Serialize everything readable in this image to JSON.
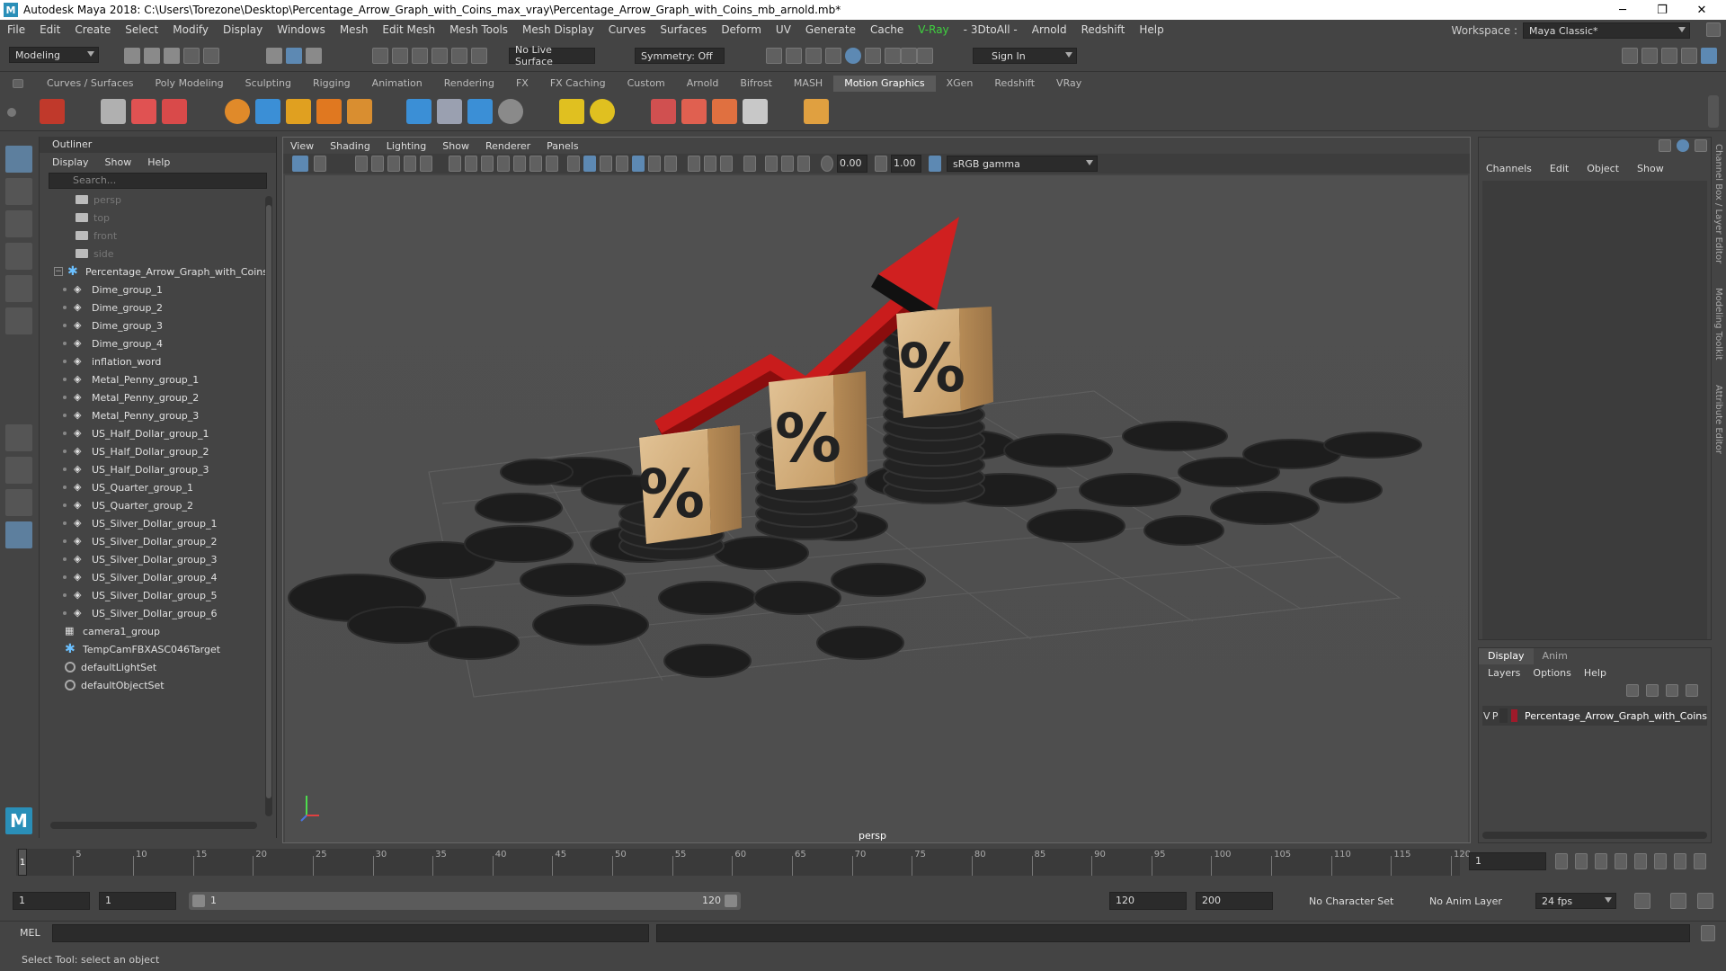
{
  "window": {
    "title": "Autodesk Maya 2018: C:\\Users\\Torezone\\Desktop\\Percentage_Arrow_Graph_with_Coins_max_vray\\Percentage_Arrow_Graph_with_Coins_mb_arnold.mb*",
    "minimize": "─",
    "maximize": "❐",
    "close": "✕"
  },
  "menubar": {
    "items": [
      "File",
      "Edit",
      "Create",
      "Select",
      "Modify",
      "Display",
      "Windows",
      "Mesh",
      "Edit Mesh",
      "Mesh Tools",
      "Mesh Display",
      "Curves",
      "Surfaces",
      "Deform",
      "UV",
      "Generate",
      "Cache",
      "V-Ray",
      "- 3DtoAll -",
      "Arnold",
      "Redshift",
      "Help"
    ],
    "workspace_label": "Workspace :",
    "workspace_value": "Maya Classic*"
  },
  "statusline": {
    "mode": "Modeling",
    "live_surface": "No Live Surface",
    "symmetry": "Symmetry: Off",
    "sign_in": "Sign In"
  },
  "shelf": {
    "tabs": [
      "Curves / Surfaces",
      "Poly Modeling",
      "Sculpting",
      "Rigging",
      "Animation",
      "Rendering",
      "FX",
      "FX Caching",
      "Custom",
      "Arnold",
      "Bifrost",
      "MASH",
      "Motion Graphics",
      "XGen",
      "Redshift",
      "VRay"
    ],
    "active_tab": "Motion Graphics"
  },
  "outliner": {
    "title": "Outliner",
    "menu": [
      "Display",
      "Show",
      "Help"
    ],
    "search_placeholder": "Search...",
    "cameras": [
      "persp",
      "top",
      "front",
      "side"
    ],
    "root": "Percentage_Arrow_Graph_with_Coins",
    "children": [
      "Dime_group_1",
      "Dime_group_2",
      "Dime_group_3",
      "Dime_group_4",
      "inflation_word",
      "Metal_Penny_group_1",
      "Metal_Penny_group_2",
      "Metal_Penny_group_3",
      "US_Half_Dollar_group_1",
      "US_Half_Dollar_group_2",
      "US_Half_Dollar_group_3",
      "US_Quarter_group_1",
      "US_Quarter_group_2",
      "US_Silver_Dollar_group_1",
      "US_Silver_Dollar_group_2",
      "US_Silver_Dollar_group_3",
      "US_Silver_Dollar_group_4",
      "US_Silver_Dollar_group_5",
      "US_Silver_Dollar_group_6"
    ],
    "others": [
      "camera1_group",
      "TempCamFBXASC046Target",
      "defaultLightSet",
      "defaultObjectSet"
    ]
  },
  "viewport": {
    "menu": [
      "View",
      "Shading",
      "Lighting",
      "Show",
      "Renderer",
      "Panels"
    ],
    "exposure": "0.00",
    "gamma": "1.00",
    "color_space": "sRGB gamma",
    "camera": "persp",
    "cube_glyph": "%"
  },
  "channelbox": {
    "menu": [
      "Channels",
      "Edit",
      "Object",
      "Show"
    ]
  },
  "layers": {
    "tabs": [
      "Display",
      "Anim"
    ],
    "menu": [
      "Layers",
      "Options",
      "Help"
    ],
    "row": {
      "v": "V",
      "p": "P",
      "name": "Percentage_Arrow_Graph_with_Coins",
      "color": "#9e1a2a"
    }
  },
  "side_tabs": [
    "Channel Box / Layer Editor",
    "Modeling Toolkit",
    "Attribute Editor"
  ],
  "timeslider": {
    "ticks": [
      "5",
      "10",
      "15",
      "20",
      "25",
      "30",
      "35",
      "40",
      "45",
      "50",
      "55",
      "60",
      "65",
      "70",
      "75",
      "80",
      "85",
      "90",
      "95",
      "100",
      "105",
      "110",
      "115",
      "120"
    ],
    "current": "1",
    "frame_field": "1"
  },
  "range": {
    "start": "1",
    "playback_start": "1",
    "range_start": "1",
    "range_end": "120",
    "playback_end": "120",
    "end": "200",
    "character_set": "No Character Set",
    "anim_layer": "No Anim Layer",
    "fps": "24 fps"
  },
  "cmdline": {
    "label": "MEL"
  },
  "helpline": {
    "text": "Select Tool: select an object"
  }
}
